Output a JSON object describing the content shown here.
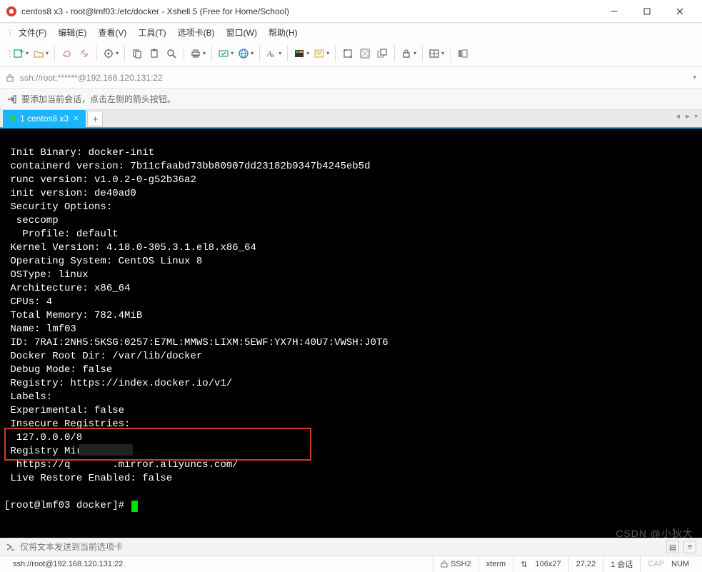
{
  "window": {
    "title": "centos8 x3 - root@lmf03:/etc/docker - Xshell 5 (Free for Home/School)"
  },
  "menu": {
    "items": [
      "文件(F)",
      "编辑(E)",
      "查看(V)",
      "工具(T)",
      "选项卡(B)",
      "窗口(W)",
      "帮助(H)"
    ]
  },
  "address": {
    "url": "ssh://root:******@192.168.120.131:22"
  },
  "hint": {
    "text": "要添加当前会话，点击左侧的箭头按钮。"
  },
  "tab": {
    "label": "1 centos8 x3"
  },
  "terminal": {
    "lines": [
      " Init Binary: docker-init",
      " containerd version: 7b11cfaabd73bb80907dd23182b9347b4245eb5d",
      " runc version: v1.0.2-0-g52b36a2",
      " init version: de40ad0",
      " Security Options:",
      "  seccomp",
      "   Profile: default",
      " Kernel Version: 4.18.0-305.3.1.el8.x86_64",
      " Operating System: CentOS Linux 8",
      " OSType: linux",
      " Architecture: x86_64",
      " CPUs: 4",
      " Total Memory: 782.4MiB",
      " Name: lmf03",
      " ID: 7RAI:2NH5:5KSG:0257:E7ML:MMWS:LIXM:5EWF:YX7H:40U7:VWSH:J0T6",
      " Docker Root Dir: /var/lib/docker",
      " Debug Mode: false",
      " Registry: https://index.docker.io/v1/",
      " Labels:",
      " Experimental: false",
      " Insecure Registries:",
      "  127.0.0.0/8",
      " Registry Mirrors:",
      "  https://q       .mirror.aliyuncs.com/",
      " Live Restore Enabled: false",
      "",
      "[root@lmf03 docker]# "
    ]
  },
  "sendbar": {
    "placeholder": "仅将文本发送到当前选项卡"
  },
  "status": {
    "left": "ssh://root@192.168.120.131:22",
    "proto": "SSH2",
    "term": "xterm",
    "size_icon": "⇅",
    "size": "106x27",
    "pos": "27,22",
    "sess": "1 会话",
    "cap": "CAP",
    "num": "NUM"
  },
  "watermark": "CSDN @小狄大"
}
